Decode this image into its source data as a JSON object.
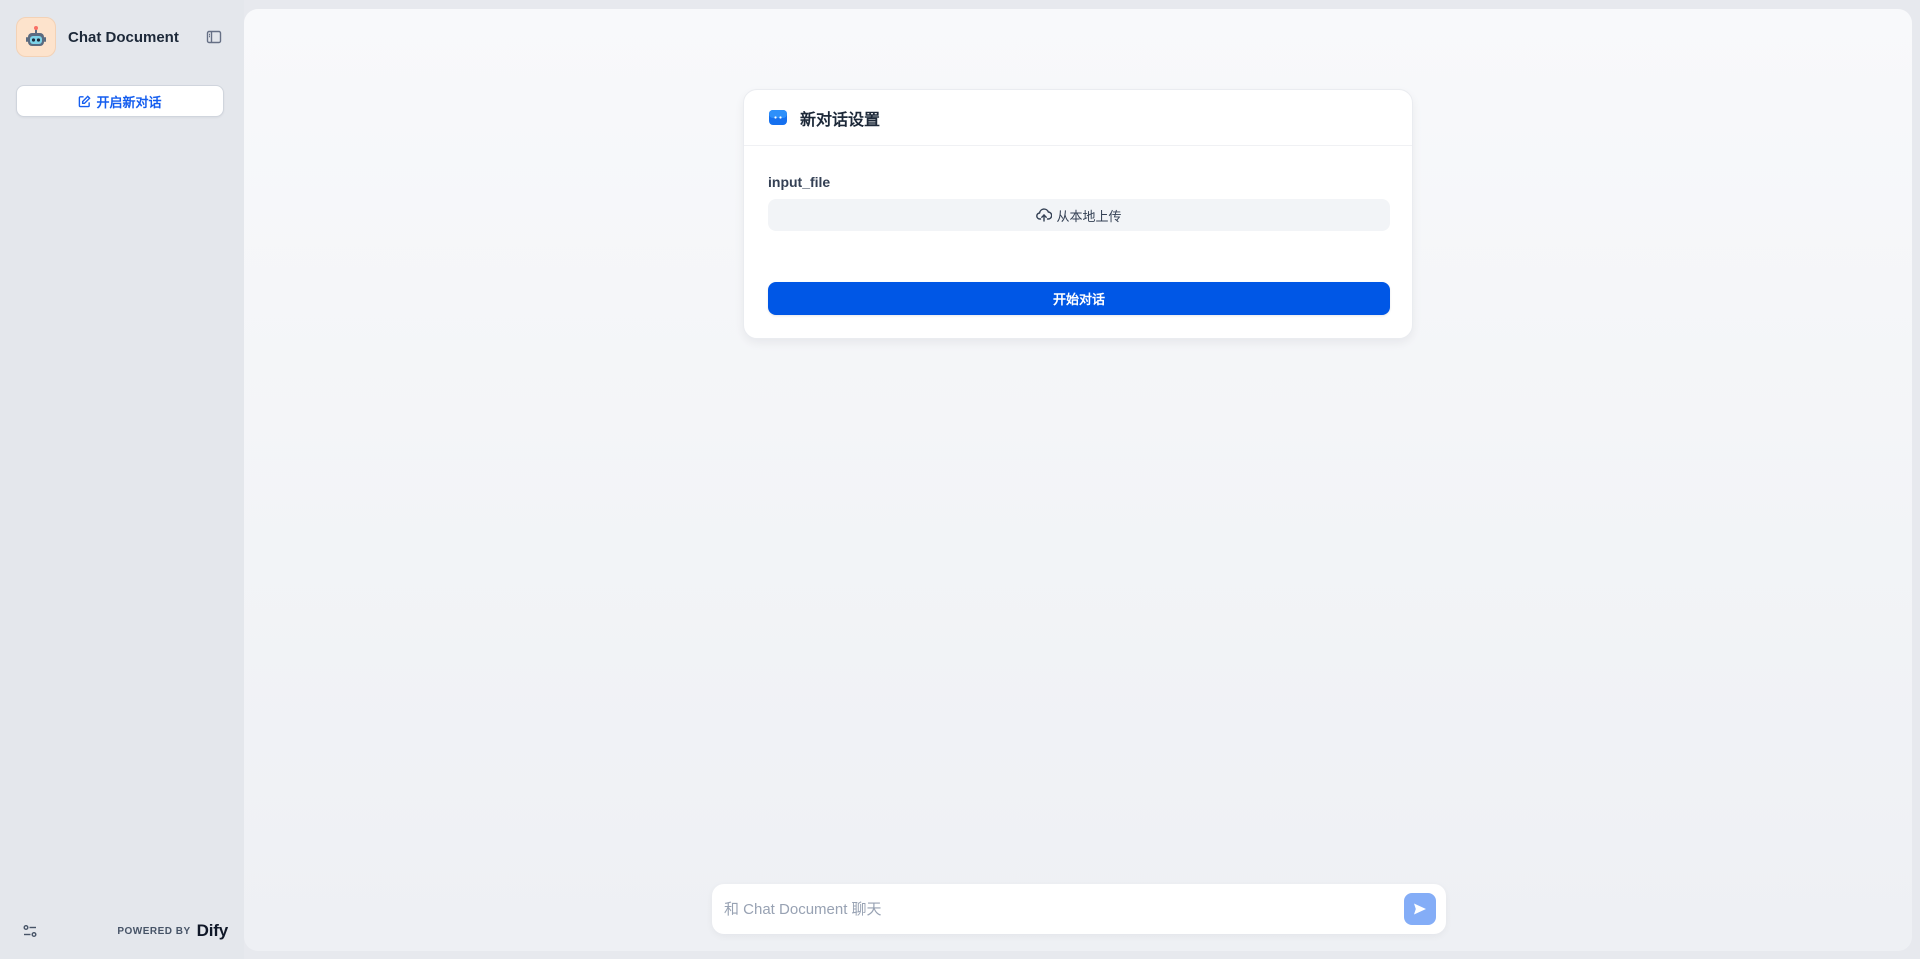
{
  "sidebar": {
    "app_name": "Chat Document",
    "app_icon": "robot-icon",
    "new_chat_label": "开启新对话",
    "powered_by_label": "POWERED BY",
    "brand_logo_text": "Dify"
  },
  "main": {
    "card": {
      "title": "新对话设置",
      "title_icon": "chat-bubble-icon",
      "field_label": "input_file",
      "upload_label": "从本地上传",
      "upload_icon": "cloud-upload-icon",
      "start_label": "开始对话"
    },
    "chat_input": {
      "placeholder": "和 Chat Document 聊天",
      "value": ""
    }
  },
  "colors": {
    "accent": "#155eef",
    "primary_button": "#0057e6",
    "send_button": "#84adf7",
    "sidebar_bg": "#e4e7ec"
  }
}
